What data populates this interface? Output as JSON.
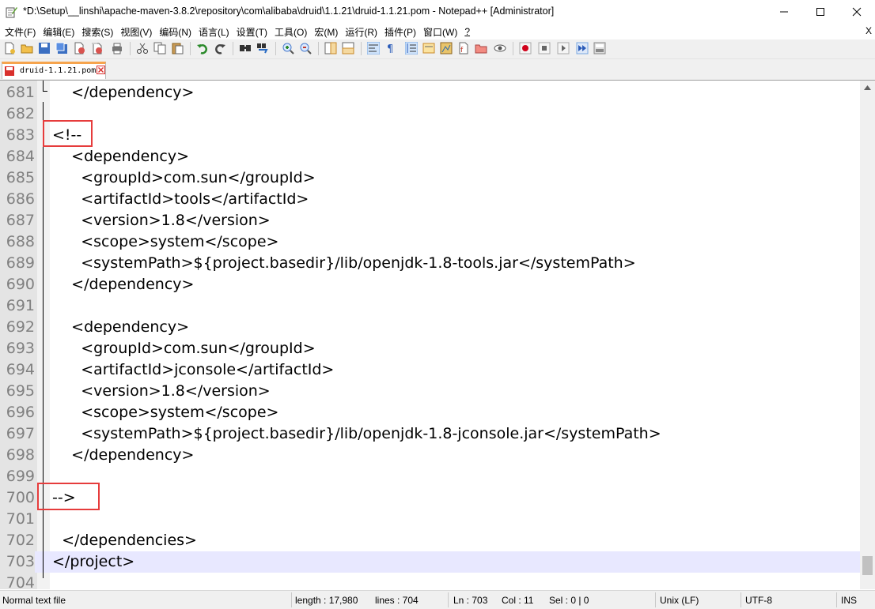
{
  "window": {
    "title": "*D:\\Setup\\__linshi\\apache-maven-3.8.2\\repository\\com\\alibaba\\druid\\1.1.21\\druid-1.1.21.pom - Notepad++ [Administrator]"
  },
  "menubar": {
    "items": [
      "文件(F)",
      "编辑(E)",
      "搜索(S)",
      "视图(V)",
      "编码(N)",
      "语言(L)",
      "设置(T)",
      "工具(O)",
      "宏(M)",
      "运行(R)",
      "插件(P)",
      "窗口(W)",
      "?"
    ],
    "close_label": "X"
  },
  "tab": {
    "label": "druid-1.1.21.pom"
  },
  "editor": {
    "current_line_index": 22,
    "lines": [
      {
        "num": "681",
        "text": "    </dependency>"
      },
      {
        "num": "682",
        "text": ""
      },
      {
        "num": "683",
        "text": "<!--"
      },
      {
        "num": "684",
        "text": "    <dependency>"
      },
      {
        "num": "685",
        "text": "      <groupId>com.sun</groupId>"
      },
      {
        "num": "686",
        "text": "      <artifactId>tools</artifactId>"
      },
      {
        "num": "687",
        "text": "      <version>1.8</version>"
      },
      {
        "num": "688",
        "text": "      <scope>system</scope>"
      },
      {
        "num": "689",
        "text": "      <systemPath>${project.basedir}/lib/openjdk-1.8-tools.jar</systemPath>"
      },
      {
        "num": "690",
        "text": "    </dependency>"
      },
      {
        "num": "691",
        "text": ""
      },
      {
        "num": "692",
        "text": "    <dependency>"
      },
      {
        "num": "693",
        "text": "      <groupId>com.sun</groupId>"
      },
      {
        "num": "694",
        "text": "      <artifactId>jconsole</artifactId>"
      },
      {
        "num": "695",
        "text": "      <version>1.8</version>"
      },
      {
        "num": "696",
        "text": "      <scope>system</scope>"
      },
      {
        "num": "697",
        "text": "      <systemPath>${project.basedir}/lib/openjdk-1.8-jconsole.jar</systemPath>"
      },
      {
        "num": "698",
        "text": "    </dependency>"
      },
      {
        "num": "699",
        "text": ""
      },
      {
        "num": "700",
        "text": "-->"
      },
      {
        "num": "701",
        "text": ""
      },
      {
        "num": "702",
        "text": "  </dependencies>"
      },
      {
        "num": "703",
        "text": "</project>"
      },
      {
        "num": "704",
        "text": ""
      }
    ]
  },
  "statusbar": {
    "file_type": "Normal text file",
    "length": "length : 17,980",
    "lines": "lines : 704",
    "ln": "Ln : 703",
    "col": "Col : 11",
    "sel": "Sel : 0 | 0",
    "eol": "Unix (LF)",
    "encoding": "UTF-8",
    "mode": "INS"
  },
  "colors": {
    "highlight_box": "#e63c3c",
    "current_line": "#e8e8ff",
    "gutter": "#e4e4e4",
    "tab_accent": "#f6a44d"
  }
}
